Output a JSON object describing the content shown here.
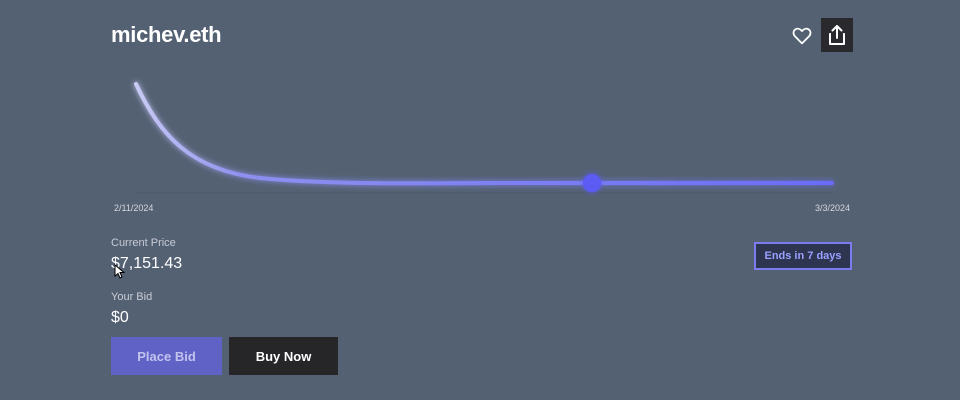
{
  "header": {
    "title": "michev.eth",
    "icons": [
      "heart-icon",
      "share-icon"
    ]
  },
  "chart": {
    "start_date": "2/11/2024",
    "end_date": "3/3/2024",
    "line_color": "#7b7cf0",
    "marker_color": "#5b5cf5"
  },
  "price": {
    "current_label": "Current Price",
    "current_value": "$7,151.43",
    "bid_label": "Your Bid",
    "bid_value": "$0"
  },
  "badge": {
    "ends_label": "Ends in 7 days"
  },
  "actions": {
    "place_bid_label": "Place Bid",
    "buy_now_label": "Buy Now"
  },
  "colors": {
    "background": "#546173",
    "accent": "#6162c6",
    "dark_button": "#262629"
  }
}
